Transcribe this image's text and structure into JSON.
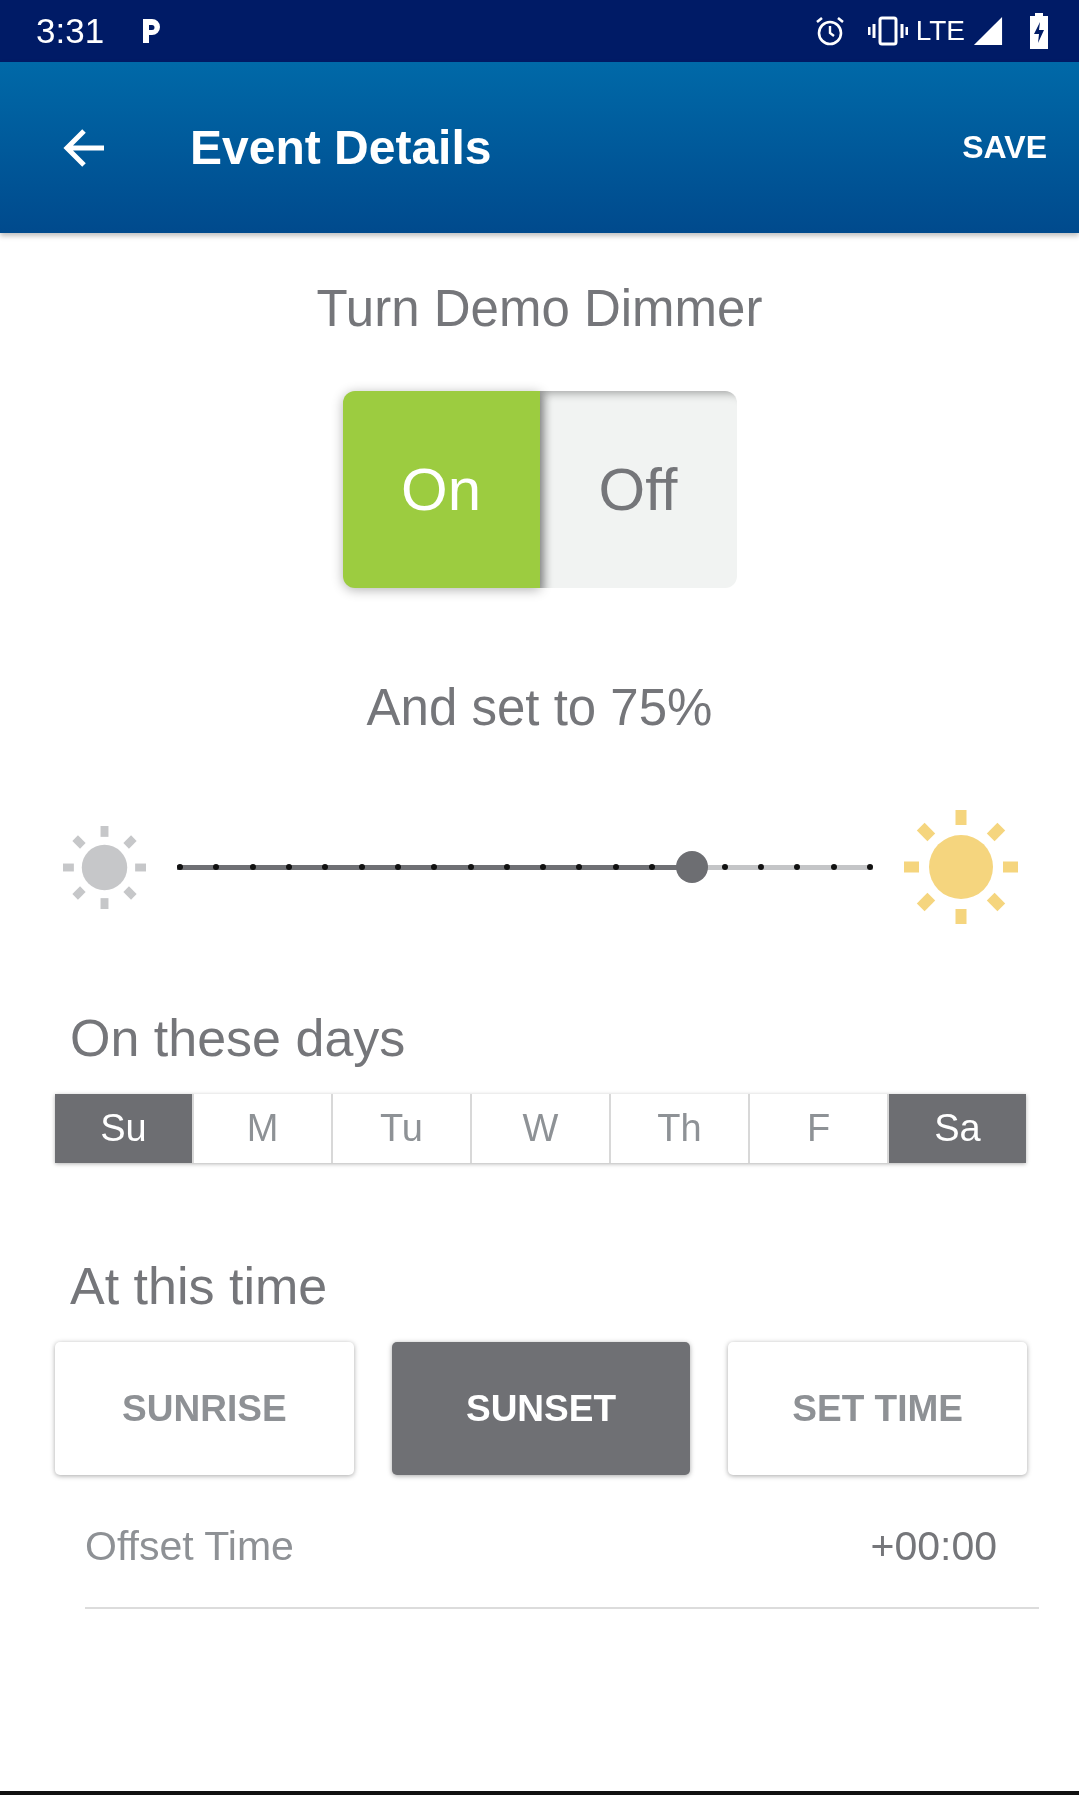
{
  "status_bar": {
    "time": "3:31",
    "network": "LTE"
  },
  "app_bar": {
    "title": "Event Details",
    "action": "SAVE"
  },
  "device_line": "Turn Demo Dimmer",
  "power_toggle": [
    {
      "label": "On",
      "selected": true
    },
    {
      "label": "Off",
      "selected": false
    }
  ],
  "brightness": {
    "label": "And set to 75%",
    "level": 0.74
  },
  "days": {
    "heading": "On these days",
    "items": [
      {
        "label": "Su",
        "selected": true
      },
      {
        "label": "M",
        "selected": false
      },
      {
        "label": "Tu",
        "selected": false
      },
      {
        "label": "W",
        "selected": false
      },
      {
        "label": "Th",
        "selected": false
      },
      {
        "label": "F",
        "selected": false
      },
      {
        "label": "Sa",
        "selected": true
      }
    ]
  },
  "time": {
    "heading": "At this time",
    "options": [
      {
        "label": "SUNRISE",
        "selected": false
      },
      {
        "label": "SUNSET",
        "selected": true
      },
      {
        "label": "SET TIME",
        "selected": false
      }
    ]
  },
  "offset": {
    "label": "Offset Time",
    "value": "+00:00"
  }
}
